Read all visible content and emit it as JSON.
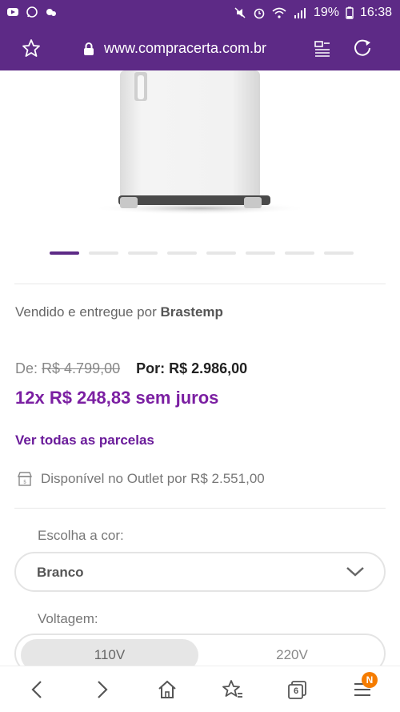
{
  "status_bar": {
    "battery": "19%",
    "time": "16:38"
  },
  "browser": {
    "url": "www.compracerta.com.br",
    "tabs_count": "6",
    "menu_badge": "N"
  },
  "product": {
    "seller_prefix": "Vendido e entregue por",
    "seller_name": "Brastemp",
    "price_from_label": "De:",
    "price_from": "R$ 4.799,00",
    "price_to": "Por: R$ 2.986,00",
    "installments": "12x R$ 248,83 sem juros",
    "all_installments_link": "Ver todas as parcelas",
    "outlet_text": "Disponível no Outlet por R$ 2.551,00",
    "carousel_dots": 8,
    "carousel_active": 0
  },
  "options": {
    "color_label": "Escolha a cor:",
    "color_value": "Branco",
    "voltage_label": "Voltagem:",
    "voltages": [
      "110V",
      "220V"
    ],
    "voltage_selected": "110V"
  },
  "colors": {
    "brand": "#5d2a86",
    "accent": "#7b1fa2",
    "badge": "#f57c00"
  }
}
